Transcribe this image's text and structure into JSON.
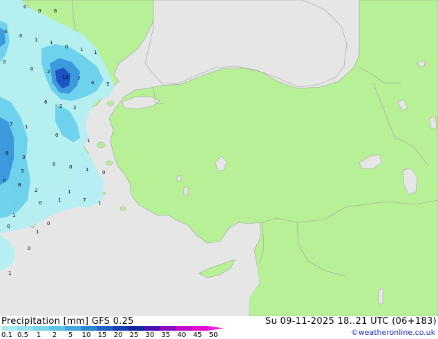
{
  "header": {
    "product": "Precipitation [mm]  GFS 0.25",
    "valid_time": "Su 09-11-2025 18..21 UTC (06+183)"
  },
  "legend": {
    "ticks": [
      "0.1",
      "0.5",
      "1",
      "2",
      "5",
      "10",
      "15",
      "20",
      "25",
      "30",
      "35",
      "40",
      "45",
      "50"
    ],
    "colors": [
      "#a8ecf2",
      "#94e2ee",
      "#7ad4ea",
      "#5ec2e4",
      "#42a8dc",
      "#2a86d0",
      "#1e62c2",
      "#1840b2",
      "#1424a0",
      "#4c10b0",
      "#8a0cbc",
      "#c00cc8",
      "#e010d0",
      "#f020e0"
    ]
  },
  "credit": "©weatheronline.co.uk",
  "colors": {
    "sea": "#e6e6e6",
    "land": "#b8f098",
    "border": "#9a9a9a",
    "precip_light": "#b4eef4",
    "precip_mid": "#6cd0ec",
    "precip_heavy": "#3a96dc",
    "precip_max": "#1e4ec0"
  },
  "precip_labels": [
    "0",
    "0",
    "6",
    "4",
    "0",
    "1",
    "1",
    "0",
    "1",
    "1",
    "0",
    "0",
    "2",
    "10",
    "7",
    "4",
    "5",
    "6",
    "2",
    "2",
    "7",
    "1",
    "6",
    "3",
    "0",
    "1",
    "0",
    "0",
    "1",
    "0",
    "0",
    "8",
    "2",
    "1",
    "1",
    "0",
    "7",
    "0",
    "1",
    "1",
    "1",
    "0",
    "3",
    "1",
    "0"
  ]
}
